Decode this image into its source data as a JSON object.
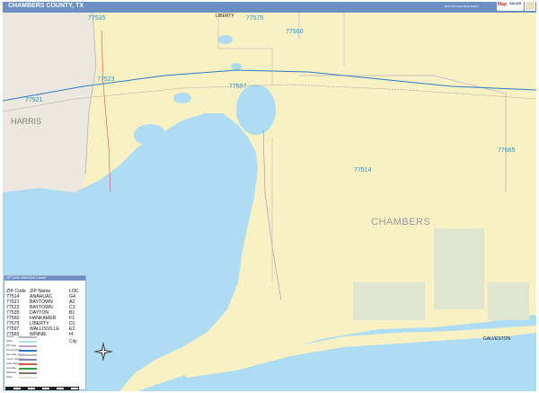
{
  "header": {
    "title": "CHAMBERS COUNTY, TX",
    "edition": "2022 ZIP Code Basic Edition",
    "brand_mark": "Map",
    "brand_sub": "SALES"
  },
  "map_labels": {
    "county": "CHAMBERS",
    "neighbor": "HARRIS",
    "zips": [
      {
        "code": "77535"
      },
      {
        "code": "77575"
      },
      {
        "code": "77560"
      },
      {
        "code": "77523"
      },
      {
        "code": "77597"
      },
      {
        "code": "77521"
      },
      {
        "code": "77514"
      },
      {
        "code": "77665"
      }
    ],
    "cities": {
      "liberty": "LIBERTY",
      "galveston": "GALVESTON"
    }
  },
  "legend": {
    "heading": "ZIP Code Index/Grid Locator",
    "columns": [
      "ZIP Code",
      "ZIP Name",
      "LOC"
    ],
    "rows": [
      [
        "77514",
        "ANAHUAC",
        "G4"
      ],
      [
        "77521",
        "BAYTOWN",
        "A2"
      ],
      [
        "77523",
        "BAYTOWN",
        "C3"
      ],
      [
        "77535",
        "DAYTON",
        "B1"
      ],
      [
        "77560",
        "HANKAMER",
        "F1"
      ],
      [
        "77575",
        "LIBERTY",
        "D1"
      ],
      [
        "77597",
        "WALLISVILLE",
        "E2"
      ],
      [
        "77665",
        "WINNIE",
        "I4"
      ]
    ],
    "symbol_city": "City",
    "symbol_labels": [
      "County",
      "Water",
      "ZIP Code",
      "Primary Roads",
      "Secondary Roads",
      "County Highways",
      "State Highways",
      "Interstate",
      "Railroads",
      "Parks"
    ]
  },
  "colors": {
    "land": "#f7f1c4",
    "water": "#aedcf2",
    "neighbor": "#ece8df",
    "park": "#dfe5cf",
    "header": "#6e8fc4",
    "zip_label": "#2b93c6",
    "interstate": "#2e7bc4"
  }
}
